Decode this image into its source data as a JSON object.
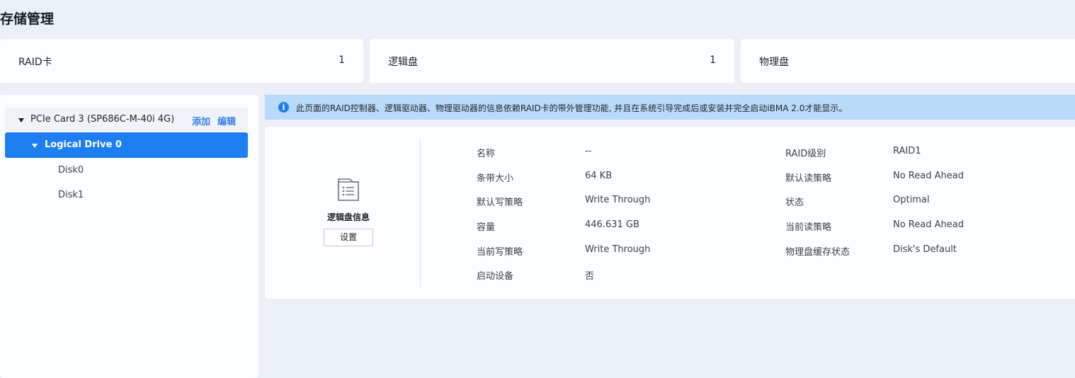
{
  "page_title": "存储管理",
  "stats": {
    "raid": {
      "label": "RAID卡",
      "count": "1"
    },
    "logical": {
      "label": "逻辑盘",
      "count": "1"
    },
    "physical": {
      "label": "物理盘",
      "count": ""
    }
  },
  "tree": {
    "controller": {
      "name": "PCIe Card 3 (SP686C-M-40i 4G)",
      "add_label": "添加",
      "edit_label": "编辑"
    },
    "logical_drive": {
      "name": "Logical Drive 0"
    },
    "disks": [
      "Disk0",
      "Disk1"
    ]
  },
  "info_banner": {
    "icon": "info-icon",
    "text": "此页面的RAID控制器、逻辑驱动器、物理驱动器的信息依赖RAID卡的带外管理功能, 并且在系统引导完成后或安装并完全启动iBMA 2.0才能显示。"
  },
  "detail": {
    "icon": "document-list-icon",
    "heading": "逻辑盘信息",
    "settings_label": "设置",
    "left_props": [
      {
        "label": "名称",
        "value": "--"
      },
      {
        "label": "条带大小",
        "value": "64 KB"
      },
      {
        "label": "默认写策略",
        "value": "Write Through"
      },
      {
        "label": "容量",
        "value": "446.631 GB"
      },
      {
        "label": "当前写策略",
        "value": "Write Through"
      },
      {
        "label": "启动设备",
        "value": "否"
      }
    ],
    "right_props": [
      {
        "label": "RAID级别",
        "value": "RAID1"
      },
      {
        "label": "默认读策略",
        "value": "No Read Ahead"
      },
      {
        "label": "状态",
        "value": "Optimal"
      },
      {
        "label": "当前读策略",
        "value": "No Read Ahead"
      },
      {
        "label": "物理盘缓存状态",
        "value": "Disk's Default"
      }
    ]
  },
  "colors": {
    "accent": "#1d7ef2",
    "banner_bg": "#b9daf9",
    "page_bg": "#ebeff6",
    "link": "#3a7ee8"
  }
}
